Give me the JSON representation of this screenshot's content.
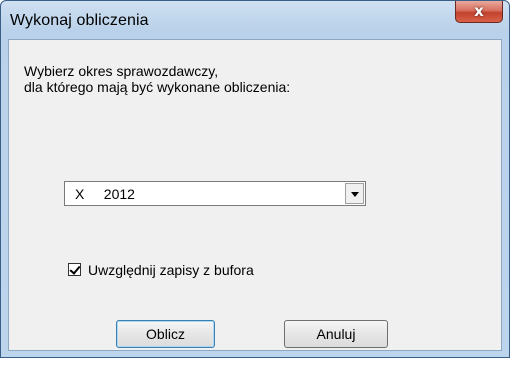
{
  "window": {
    "title": "Wykonaj obliczenia",
    "close_glyph": "x"
  },
  "prompt": {
    "line1": "Wybierz okres sprawozdawczy,",
    "line2": "dla którego mają być wykonane obliczenia:"
  },
  "period_select": {
    "selected_value": "X     2012"
  },
  "buffer_checkbox": {
    "label": "Uwzględnij zapisy z bufora",
    "checked": true
  },
  "buttons": {
    "ok_label": "Oblicz",
    "cancel_label": "Anuluj"
  }
}
